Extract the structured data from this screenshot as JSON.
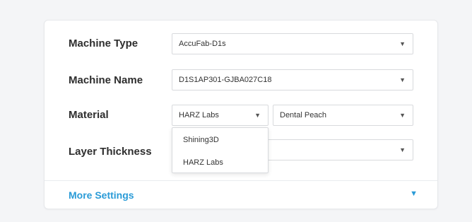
{
  "form": {
    "machine_type": {
      "label": "Machine Type",
      "value": "AccuFab-D1s"
    },
    "machine_name": {
      "label": "Machine Name",
      "value": "D1S1AP301-GJBA027C18"
    },
    "material": {
      "label": "Material",
      "brand_value": "HARZ Labs",
      "resin_value": "Dental Peach",
      "brand_options": [
        "Shining3D",
        "HARZ Labs"
      ]
    },
    "layer_thickness": {
      "label": "Layer Thickness"
    }
  },
  "more_settings": {
    "label": "More Settings"
  },
  "icons": {
    "dropdown_caret": "▼",
    "accent_color": "#2a9bd7"
  }
}
